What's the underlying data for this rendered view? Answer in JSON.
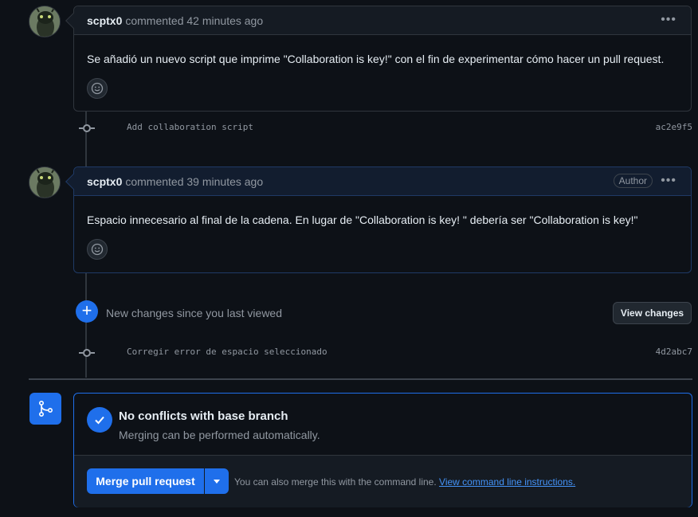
{
  "comments": [
    {
      "user": "scptx0",
      "meta": "commented 42 minutes ago",
      "badge": "",
      "body": "Se añadió un nuevo script que imprime \"Collaboration is key!\" con el fin de experimentar cómo hacer un pull request.",
      "menu_icon": "kebab-horizontal-icon",
      "reaction_icon": "smiley-icon"
    },
    {
      "user": "scptx0",
      "meta": "commented 39 minutes ago",
      "badge": "Author",
      "body": "Espacio innecesario al final de la cadena. En lugar de \"Collaboration is key! \" debería ser \"Collaboration is key!\"",
      "menu_icon": "kebab-horizontal-icon",
      "reaction_icon": "smiley-icon"
    }
  ],
  "commits": [
    {
      "message": "Add collaboration script",
      "sha": "ac2e9f5"
    },
    {
      "message": "Corregir error de espacio seleccionado",
      "sha": "4d2abc7"
    }
  ],
  "new_changes": {
    "text": "New changes since you last viewed",
    "button": "View changes",
    "icon": "plus-icon"
  },
  "merge": {
    "icon": "git-merge-icon",
    "status_icon": "check-icon",
    "title": "No conflicts with base branch",
    "subtitle": "Merging can be performed automatically.",
    "button": "Merge pull request",
    "hint": "You can also merge this with the command line.",
    "link": "View command line instructions."
  },
  "colors": {
    "background": "#0d1117",
    "accent": "#1f6feb",
    "link": "#4493f8",
    "muted": "#9198a1"
  }
}
